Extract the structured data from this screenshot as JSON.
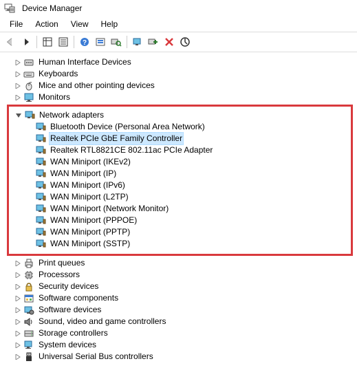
{
  "window": {
    "title": "Device Manager"
  },
  "menubar": {
    "file": "File",
    "action": "Action",
    "view": "View",
    "help": "Help"
  },
  "toolbar": {
    "back": "back",
    "forward": "forward",
    "showhide": "showhide",
    "properties": "properties",
    "help": "help",
    "optional": "optional",
    "scan": "scan",
    "monitor": "monitor",
    "add": "add",
    "remove": "remove",
    "uninstall": "uninstall"
  },
  "tree": {
    "cat_hid": "Human Interface Devices",
    "cat_keyboards": "Keyboards",
    "cat_mice": "Mice and other pointing devices",
    "cat_monitors": "Monitors",
    "cat_network": "Network adapters",
    "net_bt": "Bluetooth Device (Personal Area Network)",
    "net_realtek_gbe": "Realtek PCIe GbE Family Controller",
    "net_realtek_wifi": "Realtek RTL8821CE 802.11ac PCIe Adapter",
    "net_wan_ikev2": "WAN Miniport (IKEv2)",
    "net_wan_ip": "WAN Miniport (IP)",
    "net_wan_ipv6": "WAN Miniport (IPv6)",
    "net_wan_l2tp": "WAN Miniport (L2TP)",
    "net_wan_netmon": "WAN Miniport (Network Monitor)",
    "net_wan_pppoe": "WAN Miniport (PPPOE)",
    "net_wan_pptp": "WAN Miniport (PPTP)",
    "net_wan_sstp": "WAN Miniport (SSTP)",
    "cat_print": "Print queues",
    "cat_processors": "Processors",
    "cat_security": "Security devices",
    "cat_sw_components": "Software components",
    "cat_sw_devices": "Software devices",
    "cat_sound": "Sound, video and game controllers",
    "cat_storage": "Storage controllers",
    "cat_system": "System devices",
    "cat_usb": "Universal Serial Bus controllers"
  }
}
